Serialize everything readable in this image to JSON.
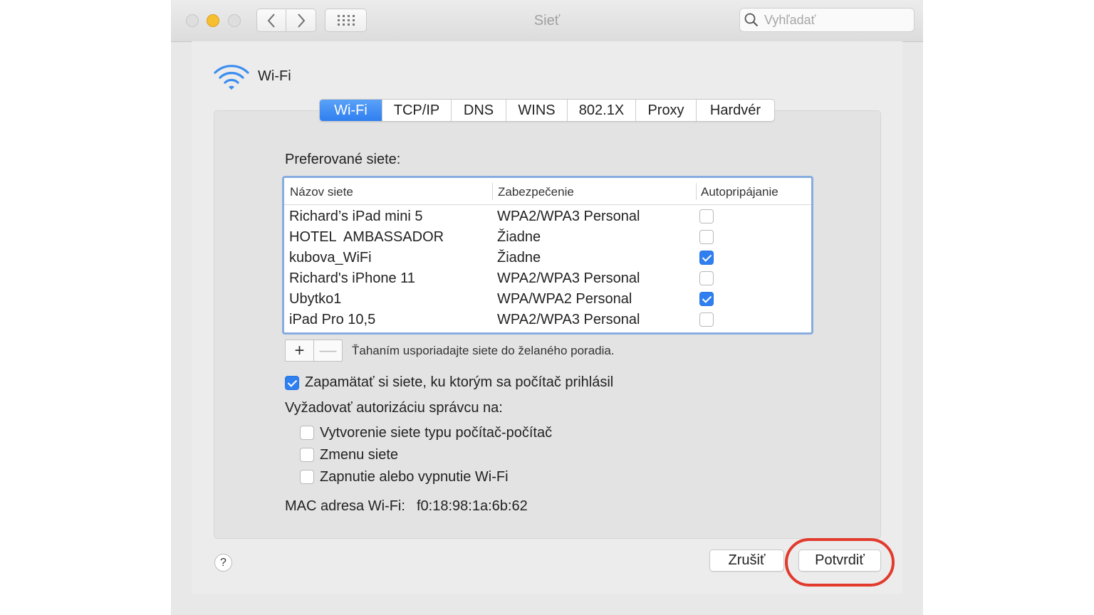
{
  "window": {
    "title": "Sieť",
    "search_placeholder": "Vyhľadať"
  },
  "header": {
    "icon": "wifi-icon",
    "label": "Wi-Fi"
  },
  "tabs": [
    {
      "label": "Wi-Fi",
      "active": true
    },
    {
      "label": "TCP/IP",
      "active": false
    },
    {
      "label": "DNS",
      "active": false
    },
    {
      "label": "WINS",
      "active": false
    },
    {
      "label": "802.1X",
      "active": false
    },
    {
      "label": "Proxy",
      "active": false
    },
    {
      "label": "Hardvér",
      "active": false
    }
  ],
  "preferred": {
    "label": "Preferované siete:",
    "columns": [
      "Názov siete",
      "Zabezpečenie",
      "Autopripájanie"
    ],
    "rows": [
      {
        "name": "Richard’s iPad mini 5",
        "security": "WPA2/WPA3 Personal",
        "auto": false
      },
      {
        "name": "HOTEL  AMBASSADOR",
        "security": "Žiadne",
        "auto": false
      },
      {
        "name": "kubova_WiFi",
        "security": "Žiadne",
        "auto": true
      },
      {
        "name": "Richard's iPhone 11",
        "security": "WPA2/WPA3 Personal",
        "auto": false
      },
      {
        "name": "Ubytko1",
        "security": "WPA/WPA2 Personal",
        "auto": true
      },
      {
        "name": "iPad Pro 10,5",
        "security": "WPA2/WPA3 Personal",
        "auto": false
      }
    ],
    "add_label": "+",
    "remove_label": "—",
    "hint": "Ťahaním usporiadajte siete do želaného poradia."
  },
  "options": {
    "remember": {
      "label": "Zapamätať si siete, ku ktorým sa počítač prihlásil",
      "checked": true
    },
    "admin_label": "Vyžadovať autorizáciu správcu na:",
    "admin_items": [
      {
        "label": "Vytvorenie siete typu počítač-počítač",
        "checked": false
      },
      {
        "label": "Zmenu siete",
        "checked": false
      },
      {
        "label": "Zapnutie alebo vypnutie Wi-Fi",
        "checked": false
      }
    ]
  },
  "mac": {
    "label": "MAC adresa Wi-Fi:",
    "value": "f0:18:98:1a:6b:62"
  },
  "footer": {
    "help_label": "?",
    "cancel_label": "Zrušiť",
    "ok_label": "Potvrdiť"
  },
  "colors": {
    "accent": "#2f7ff0",
    "highlight": "#e23a2c"
  }
}
